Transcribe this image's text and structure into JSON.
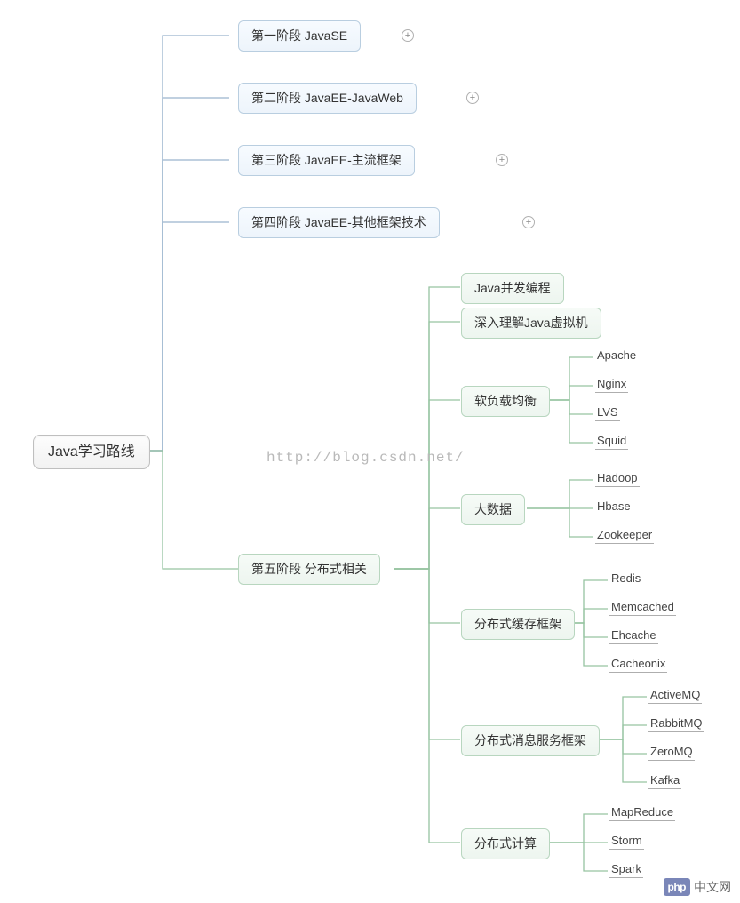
{
  "root": {
    "label": "Java学习路线"
  },
  "stages": {
    "s1": {
      "label": "第一阶段 JavaSE"
    },
    "s2": {
      "label": "第二阶段 JavaEE-JavaWeb"
    },
    "s3": {
      "label": "第三阶段 JavaEE-主流框架"
    },
    "s4": {
      "label": "第四阶段 JavaEE-其他框架技术"
    },
    "s5": {
      "label": "第五阶段 分布式相关"
    }
  },
  "s5_children": {
    "c1": {
      "label": "Java并发编程"
    },
    "c2": {
      "label": "深入理解Java虚拟机"
    },
    "c3": {
      "label": "软负载均衡",
      "items": [
        "Apache",
        "Nginx",
        "LVS",
        "Squid"
      ]
    },
    "c4": {
      "label": "大数据",
      "items": [
        "Hadoop",
        "Hbase",
        "Zookeeper"
      ]
    },
    "c5": {
      "label": "分布式缓存框架",
      "items": [
        "Redis",
        "Memcached",
        "Ehcache",
        "Cacheonix"
      ]
    },
    "c6": {
      "label": "分布式消息服务框架",
      "items": [
        "ActiveMQ",
        "RabbitMQ",
        "ZeroMQ",
        "Kafka"
      ]
    },
    "c7": {
      "label": "分布式计算",
      "items": [
        "MapReduce",
        "Storm",
        "Spark"
      ]
    }
  },
  "watermark": "http://blog.csdn.net/",
  "footer": "中文网"
}
